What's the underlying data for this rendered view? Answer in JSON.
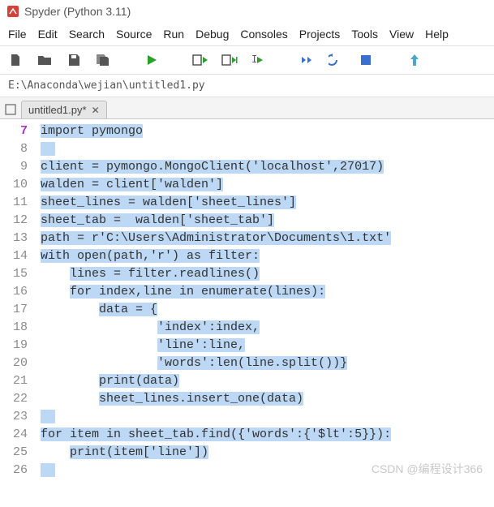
{
  "window": {
    "title": "Spyder (Python 3.11)"
  },
  "menu": {
    "file": "File",
    "edit": "Edit",
    "search": "Search",
    "source": "Source",
    "run": "Run",
    "debug": "Debug",
    "consoles": "Consoles",
    "projects": "Projects",
    "tools": "Tools",
    "view": "View",
    "help": "Help"
  },
  "path": "E:\\Anaconda\\wejian\\untitled1.py",
  "tab": {
    "label": "untitled1.py*"
  },
  "current_line": 7,
  "code": [
    "import pymongo",
    "",
    "client = pymongo.MongoClient('localhost',27017)",
    "walden = client['walden']",
    "sheet_lines = walden['sheet_lines']",
    "sheet_tab =  walden['sheet_tab']",
    "path = r'C:\\Users\\Administrator\\Documents\\1.txt'",
    "with open(path,'r') as filter:",
    "    lines = filter.readlines()",
    "    for index,line in enumerate(lines):",
    "        data = {",
    "                'index':index,",
    "                'line':line,",
    "                'words':len(line.split())}",
    "        print(data)",
    "        sheet_lines.insert_one(data)",
    "",
    "for item in sheet_tab.find({'words':{'$lt':5}}):",
    "    print(item['line'])",
    ""
  ],
  "watermark": "CSDN @编程设计366"
}
